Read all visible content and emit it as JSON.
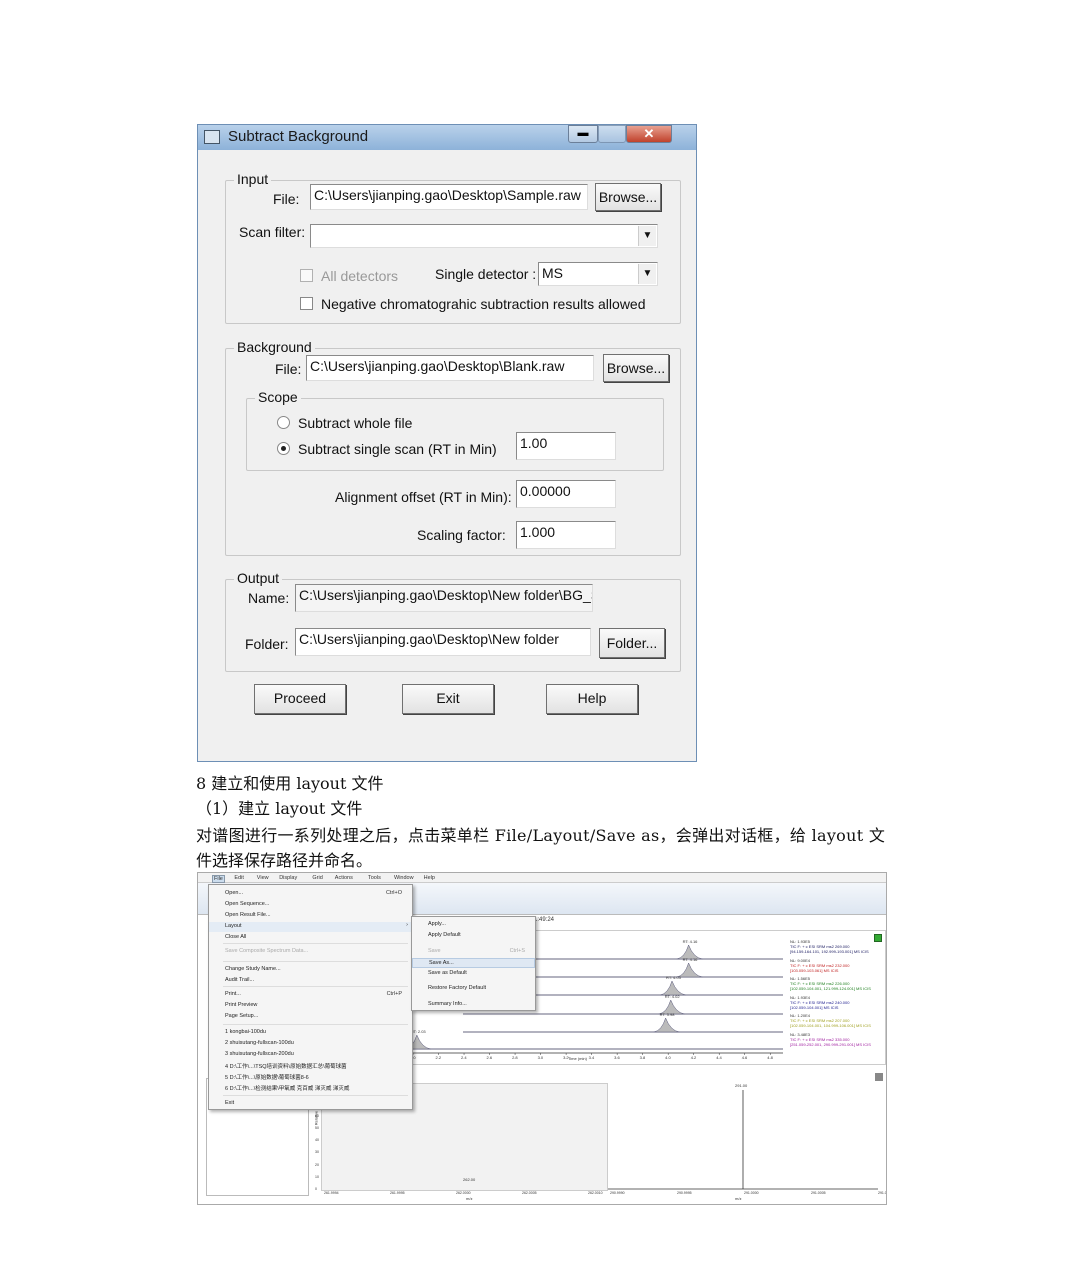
{
  "dialog": {
    "title": "Subtract Background",
    "input": {
      "legend": "Input",
      "file_label": "File:",
      "file_value": "C:\\Users\\jianping.gao\\Desktop\\Sample.raw",
      "browse": "Browse...",
      "scan_filter_label": "Scan filter:",
      "scan_filter_value": "",
      "all_detectors": "All detectors",
      "all_detectors_checked": false,
      "single_detector_label": "Single detector :",
      "single_detector_value": "MS",
      "negative_label": "Negative chromatograhic subtraction results allowed",
      "negative_checked": false
    },
    "background": {
      "legend": "Background",
      "file_label": "File:",
      "file_value": "C:\\Users\\jianping.gao\\Desktop\\Blank.raw",
      "browse": "Browse...",
      "scope_legend": "Scope",
      "whole_file": "Subtract whole file",
      "single_scan": "Subtract single scan (RT in Min)",
      "selected": "single_scan",
      "single_scan_value": "1.00",
      "alignment_label": "Alignment offset (RT in Min):",
      "alignment_value": "0.00000",
      "scaling_label": "Scaling factor:",
      "scaling_value": "1.000"
    },
    "output": {
      "legend": "Output",
      "name_label": "Name:",
      "name_value": "C:\\Users\\jianping.gao\\Desktop\\New folder\\BG_S",
      "folder_label": "Folder:",
      "folder_value": "C:\\Users\\jianping.gao\\Desktop\\New folder",
      "folder_button": "Folder..."
    },
    "buttons": {
      "proceed": "Proceed",
      "exit": "Exit",
      "help": "Help"
    }
  },
  "text": {
    "heading": "8  建立和使用 layout 文件",
    "subheading": "（1）建立 layout 文件",
    "para1": "对谱图进行一系列处理之后，点击菜单栏 File/Layout/Save  as，会弹出对话框，给 layout 文",
    "para2": "件选择保存路径并命名。"
  },
  "app": {
    "menubar": [
      "File",
      "Edit",
      "View",
      "Display",
      "Grid",
      "Actions",
      "Tools",
      "Window",
      "Help"
    ],
    "time_label": "1:49:24",
    "file_menu": [
      {
        "label": "Open...",
        "shortcut": "Ctrl+O"
      },
      {
        "label": "Open Sequence..."
      },
      {
        "label": "Open Result File..."
      },
      {
        "label": "Layout",
        "submenu": true
      },
      {
        "label": "Close All"
      },
      {
        "label": "Save Composite Spectrum Data...",
        "disabled": true
      },
      {
        "label": "Change Study Name..."
      },
      {
        "label": "Audit Trail..."
      },
      {
        "label": "Print...",
        "shortcut": "Ctrl+P"
      },
      {
        "label": "Print Preview"
      },
      {
        "label": "Page Setup..."
      },
      {
        "label": "1 kongbai-100du"
      },
      {
        "label": "2 shuisutang-fullscan-100du"
      },
      {
        "label": "3 shuisutang-fullscan-200du"
      },
      {
        "label": "4 D:\\工作\\...\\TSQ培训资料\\原始数据汇总\\葡萄球菌"
      },
      {
        "label": "5 D:\\工作\\...\\原始数据\\葡萄球菌8-6"
      },
      {
        "label": "6 D:\\工作\\...\\检测结果\\甲氧威 克百威 涕灭威 涕灭威"
      },
      {
        "label": "Exit"
      }
    ],
    "layout_menu": [
      {
        "label": "Apply..."
      },
      {
        "label": "Apply Default"
      },
      {
        "label": "Save",
        "shortcut": "Ctrl+S",
        "disabled": true
      },
      {
        "label": "Save As...",
        "highlighted": true
      },
      {
        "label": "Save as Default"
      },
      {
        "label": "Restore Factory Default"
      },
      {
        "label": "Summary Info..."
      }
    ],
    "chromatogram": {
      "x_label": "Time (min)",
      "ticks": [
        "2.0",
        "2.2",
        "2.4",
        "2.6",
        "2.8",
        "3.0",
        "3.2",
        "3.4",
        "3.6",
        "3.8",
        "4.0",
        "4.2",
        "4.4",
        "4.6",
        "4.8"
      ],
      "traces": [
        {
          "rt": "RT: 4.16",
          "color": "#1a1a60",
          "nl": "NL: 1.93E5",
          "filter": "TIC F: + c ESI SRM ms2 269.000",
          "mass": "[94.159-164.101, 192.999-193.001] MS  ICIS"
        },
        {
          "rt": "RT: 4.16",
          "color": "#c02020",
          "nl": "NL: 9.00E4",
          "filter": "TIC F: + c ESI SRM ms2 232.000",
          "mass": "[103.059-103.061] MS  ICIS"
        },
        {
          "rt": "RT: 4.03",
          "color": "#208020",
          "nl": "NL: 1.56E5",
          "filter": "TIC F: + c ESI SRM ms2 226.000",
          "mass": "[102.059-104.001, 121.999-124.001] MS  ICIS"
        },
        {
          "rt": "RT: 4.02",
          "color": "#202090",
          "nl": "NL: 1.93E4",
          "filter": "TIC F: + c ESI SRM ms2 240.000",
          "mass": "[102.059-104.001] MS  ICIS"
        },
        {
          "rt": "RT: 3.98",
          "color": "#a0a020",
          "nl": "NL: 1.20E4",
          "filter": "TIC F: + c ESI SRM ms2 207.000",
          "mass": "[102.059-104.001, 104.999-106.001] MS  ICIS"
        },
        {
          "rt": "RT: 2.03",
          "color": "#a020a0",
          "nl": "NL: 3.48E3",
          "filter": "TIC F: + c ESI SRM ms2 335.000",
          "mass": "[251.059-252.001, 290.999-291.001] MS  ICIS"
        }
      ]
    },
    "spectrum": {
      "x_label": "m/z",
      "y_label": "Relative Abundance",
      "y_ticks": [
        "0",
        "10",
        "20",
        "30",
        "40",
        "50",
        "60",
        "70"
      ],
      "left_ticks": [
        "261.9994",
        "261.9995",
        "262.0000",
        "262.0005",
        "262.0010"
      ],
      "right_ticks": [
        "290.9990",
        "290.9995",
        "291.0000",
        "291.0005",
        "291.0010"
      ],
      "peak_left": "262.00",
      "peak_right": "291.00"
    }
  }
}
